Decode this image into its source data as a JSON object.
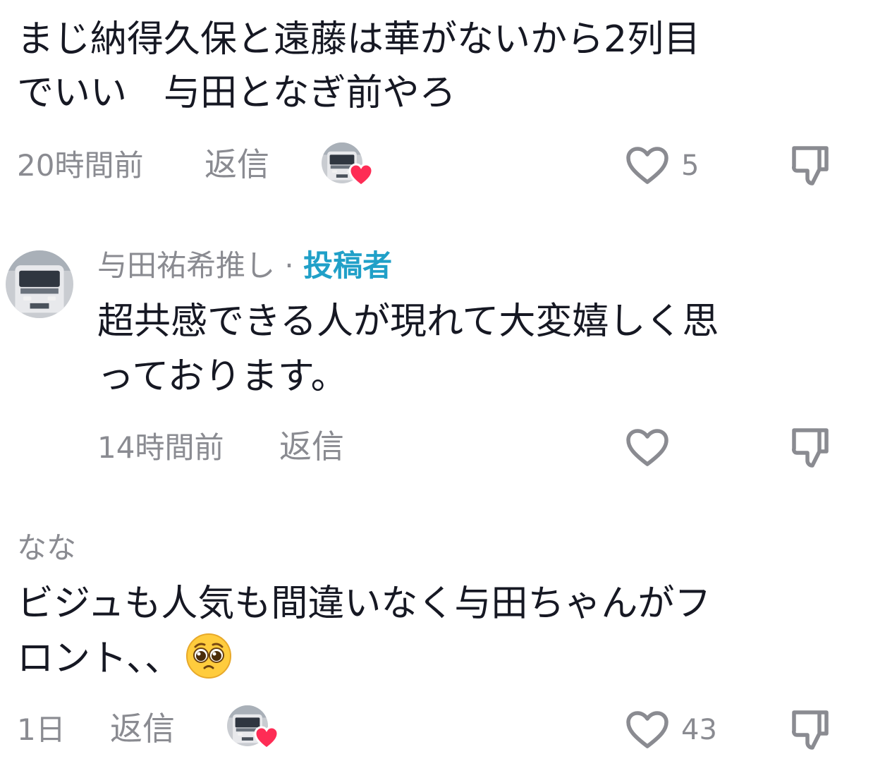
{
  "comments": [
    {
      "text_line1": "まじ納得久保と遠藤は華がないから2列目",
      "text_line2": "でいい　与田となぎ前やろ",
      "time": "20時間前",
      "reply_label": "返信",
      "like_count": "5",
      "creator_liked": true
    },
    {
      "username": "与田祐希推し",
      "separator": "·",
      "creator_label": "投稿者",
      "text_line1": "超共感できる人が現れて大変嬉しく思",
      "text_line2": "っております。",
      "time": "14時間前",
      "reply_label": "返信",
      "like_count": "",
      "creator_liked": false
    },
    {
      "username": "なな",
      "text_line1": "ビジュも人気も間違いなく与田ちゃんがフ",
      "text_line2": "ロント、、",
      "emoji": "pleading-face-emoji",
      "time": "1日",
      "reply_label": "返信",
      "like_count": "43",
      "creator_liked": true
    }
  ],
  "icons": {
    "like": "heart-outline-icon",
    "dislike": "thumbs-down-icon",
    "creator_badge": "red-heart-icon"
  },
  "colors": {
    "text": "#161823",
    "muted": "#8a8b91",
    "creator": "#20a0c8",
    "heart_badge": "#fe2c55"
  }
}
